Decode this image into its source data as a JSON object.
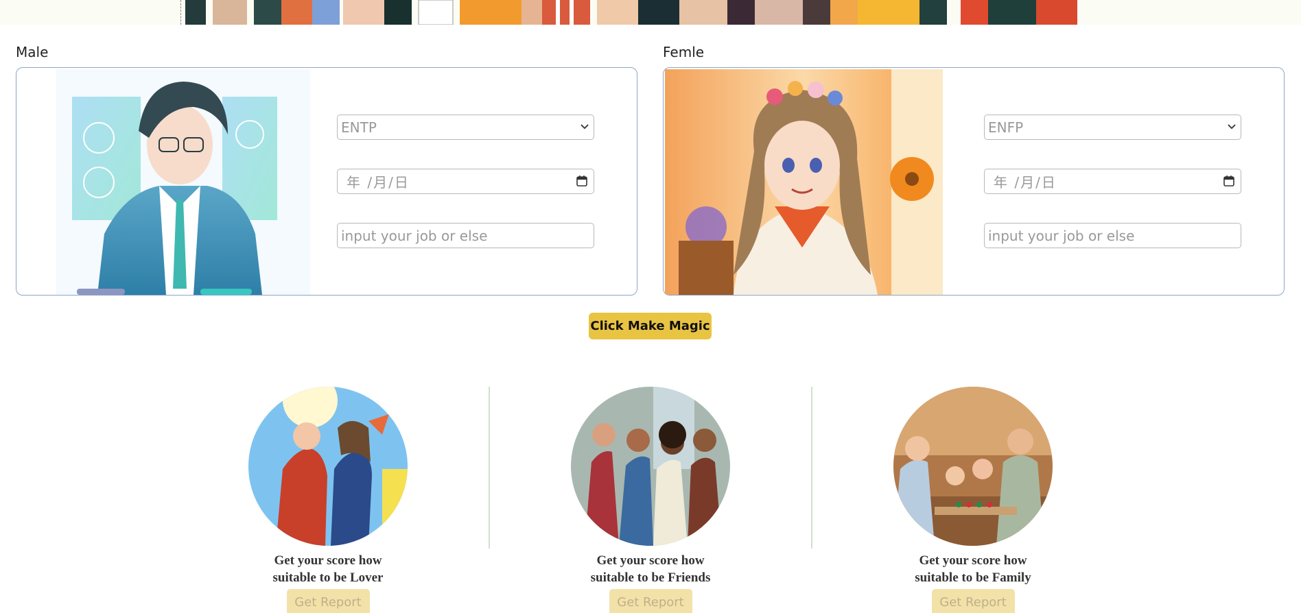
{
  "male": {
    "label": "Male",
    "mbti": "ENTP",
    "date_placeholder": "年 /月/日",
    "job_placeholder": "input your job or else"
  },
  "female": {
    "label": "Femle",
    "mbti": "ENFP",
    "date_placeholder": "年 /月/日",
    "job_placeholder": "input your job or else"
  },
  "magic_button": "Click Make Magic",
  "features": [
    {
      "line1": "Get your score how",
      "line2": "suitable to be Lover",
      "button": "Get Report"
    },
    {
      "line1": "Get your score how",
      "line2": "suitable to be Friends",
      "button": "Get Report"
    },
    {
      "line1": "Get your score how",
      "line2": "suitable to be Family",
      "button": "Get Report"
    }
  ],
  "colors": {
    "accent": "#e9c443",
    "report_button": "#f2e2a8",
    "card_border": "#8ea6c9",
    "divider": "#cfe2cc"
  }
}
